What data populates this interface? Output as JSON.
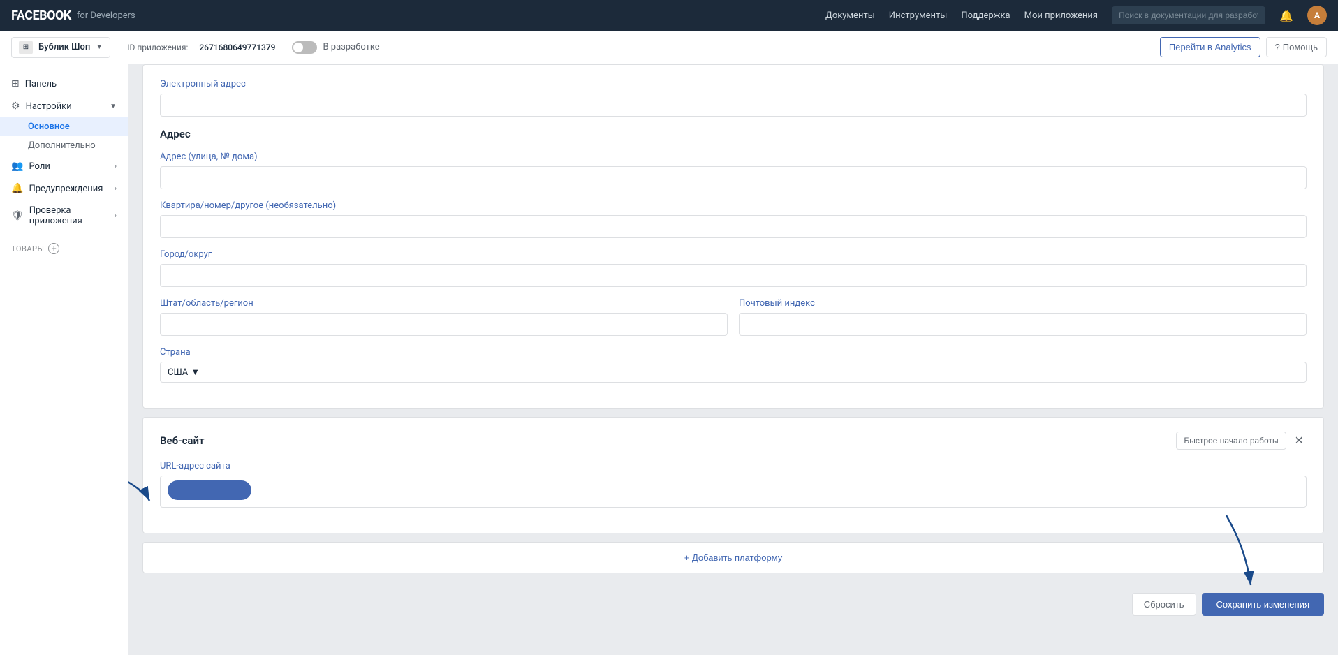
{
  "topnav": {
    "logo": "FACEBOOK",
    "logo_sub": "for Developers",
    "links": [
      "Документы",
      "Инструменты",
      "Поддержка",
      "Мои приложения"
    ],
    "search_placeholder": "Поиск в документации для разработчиков"
  },
  "subheader": {
    "app_name": "Бублик Шоп",
    "app_id_label": "ID приложения:",
    "app_id_value": "2671680649771379",
    "toggle_label": "В разработке",
    "analytics_btn": "Перейти в Analytics",
    "help_btn": "Помощь"
  },
  "sidebar": {
    "items": [
      {
        "label": "Панель",
        "icon": "⊞",
        "active": false
      },
      {
        "label": "Настройки",
        "icon": "⚙",
        "active": false,
        "has_arrow": true
      },
      {
        "label": "Основное",
        "sub": true,
        "active": true
      },
      {
        "label": "Дополнительно",
        "sub": true,
        "active": false
      },
      {
        "label": "Роли",
        "icon": "👥",
        "active": false,
        "has_arrow": true
      },
      {
        "label": "Предупреждения",
        "icon": "🔔",
        "active": false,
        "has_arrow": true
      },
      {
        "label": "Проверка приложения",
        "icon": "🛡",
        "active": false,
        "has_arrow": true
      }
    ],
    "section_label": "ТОВАРЫ",
    "section_plus": "+"
  },
  "form": {
    "email_label": "Электронный адрес",
    "email_value": "",
    "address_section": "Адрес",
    "address_street_label": "Адрес (улица, № дома)",
    "address_street_value": "",
    "address_apt_label": "Квартира/номер/другое (необязательно)",
    "address_apt_value": "",
    "address_city_label": "Город/округ",
    "address_city_value": "",
    "address_state_label": "Штат/область/регион",
    "address_state_value": "",
    "address_zip_label": "Почтовый индекс",
    "address_zip_value": "",
    "country_label": "Страна",
    "country_value": "США"
  },
  "website_card": {
    "title": "Веб-сайт",
    "quick_start_btn": "Быстрое начало работы",
    "url_label": "URL-адрес сайта",
    "url_value": ""
  },
  "add_platform": {
    "label": "+ Добавить платформу"
  },
  "footer": {
    "reset_btn": "Сбросить",
    "save_btn": "Сохранить изменения"
  }
}
